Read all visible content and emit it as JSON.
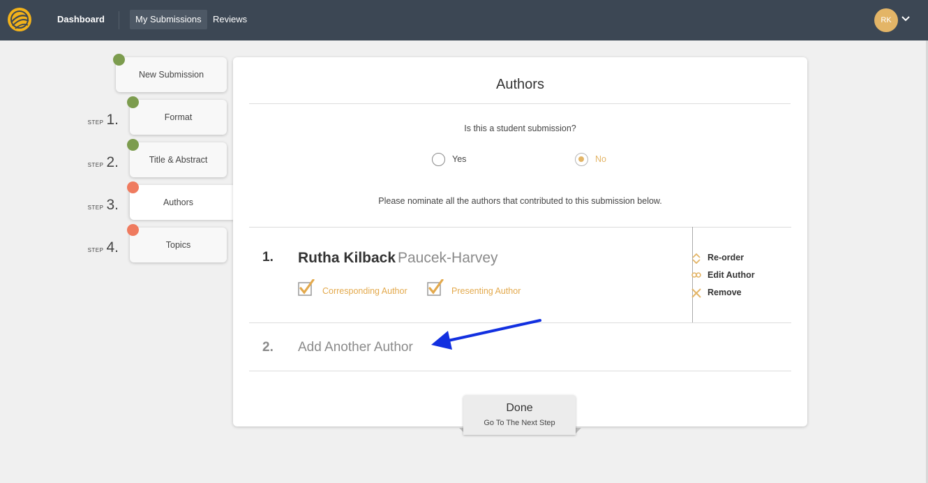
{
  "nav": {
    "logo": "app-logo",
    "dashboard": "Dashboard",
    "my_submissions": "My Submissions",
    "reviews": "Reviews",
    "avatar_initials": "RK"
  },
  "steps": {
    "new_submission": "New Submission",
    "step_word": "STEP",
    "items": [
      {
        "num": "1.",
        "label": "Format",
        "status": "complete"
      },
      {
        "num": "2.",
        "label": "Title & Abstract",
        "status": "complete"
      },
      {
        "num": "3.",
        "label": "Authors",
        "status": "incomplete",
        "active": true
      },
      {
        "num": "4.",
        "label": "Topics",
        "status": "incomplete"
      }
    ]
  },
  "panel": {
    "title": "Authors",
    "student_question": "Is this a student submission?",
    "yes_label": "Yes",
    "no_label": "No",
    "selected": "No",
    "nominate_text": "Please nominate all the authors that contributed to this submission below."
  },
  "authors": [
    {
      "num": "1.",
      "name": "Rutha Kilback",
      "organization": "Paucek-Harvey",
      "corresponding_label": "Corresponding Author",
      "corresponding": true,
      "presenting_label": "Presenting Author",
      "presenting": true
    }
  ],
  "actions": {
    "reorder": "Re-order",
    "edit": "Edit Author",
    "remove": "Remove"
  },
  "add_author": {
    "num": "2.",
    "label": "Add Another Author"
  },
  "done": {
    "title": "Done",
    "subtitle": "Go To The Next Step"
  },
  "colors": {
    "nav_bg": "#3c4754",
    "accent_gold": "#e3b567",
    "complete_green": "#7c9c4e",
    "incomplete_red": "#ef7b5f",
    "annotation_arrow": "#1230e0"
  }
}
